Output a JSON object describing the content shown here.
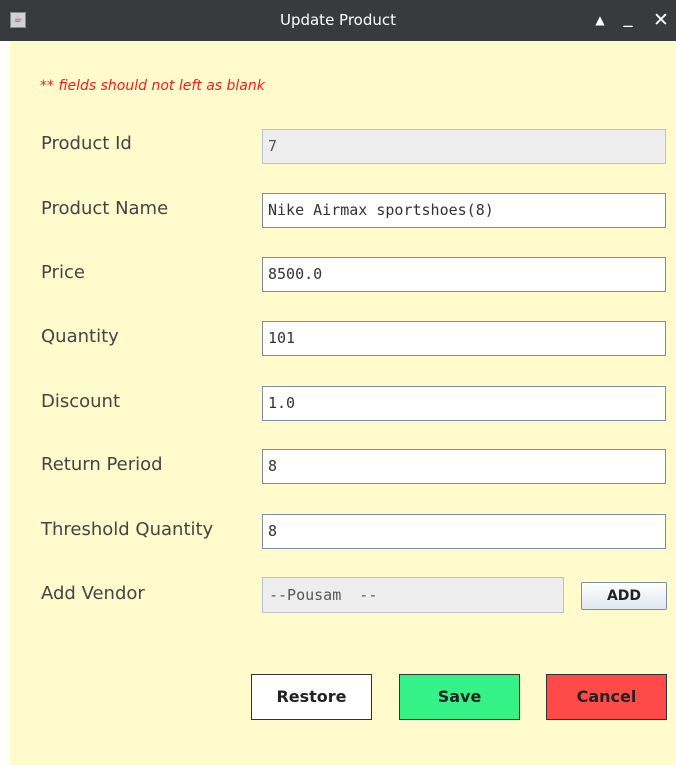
{
  "window": {
    "title": "Update Product",
    "icon": "java-icon",
    "controls": {
      "maximize": "▲",
      "minimize": "_",
      "close": "✕"
    }
  },
  "form": {
    "note": "** fields should not left as blank",
    "fields": [
      {
        "label": "Product Id",
        "value": "7",
        "disabled": true
      },
      {
        "label": "Product Name",
        "value": "Nike Airmax sportshoes(8)"
      },
      {
        "label": "Price",
        "value": "8500.0"
      },
      {
        "label": "Quantity",
        "value": "101"
      },
      {
        "label": "Discount",
        "value": "1.0"
      },
      {
        "label": "Return Period",
        "value": "8"
      },
      {
        "label": "Threshold Quantity",
        "value": "8"
      }
    ],
    "vendor": {
      "label": "Add Vendor",
      "value": "--Pousam  --",
      "add_label": "ADD"
    }
  },
  "buttons": {
    "restore": "Restore",
    "save": "Save",
    "cancel": "Cancel"
  },
  "colors": {
    "background": "#fffbcc",
    "note": "#ff1a1a",
    "save": "#34f287",
    "cancel": "#ff4a4a",
    "titlebar": "#373b3e"
  }
}
